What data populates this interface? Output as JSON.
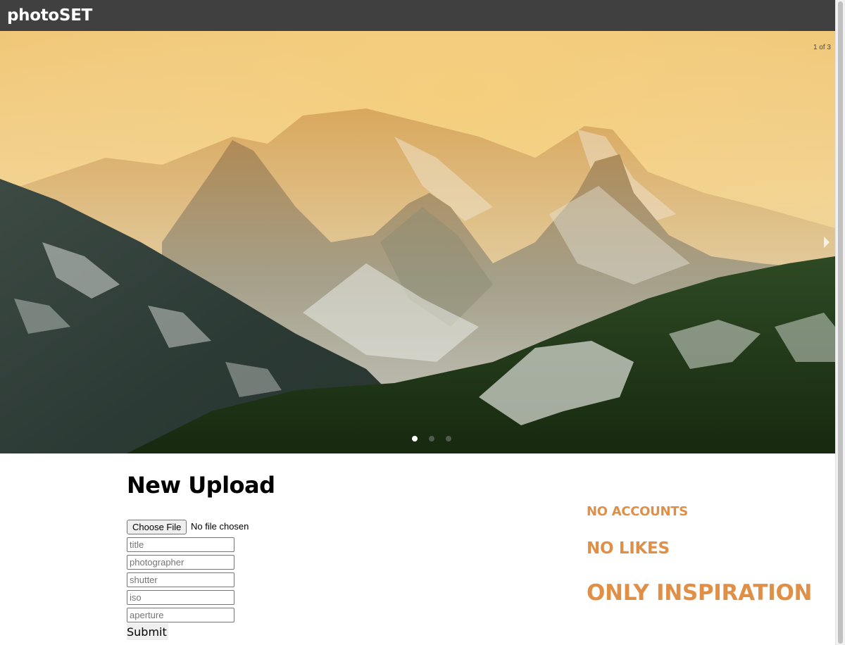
{
  "header": {
    "brand": "photoSET"
  },
  "carousel": {
    "counter": "1 of 3",
    "dots": 3,
    "active_dot": 1,
    "image": "snowy-mountains-golden-haze"
  },
  "upload": {
    "title": "New Upload",
    "file_button": "Choose File",
    "file_status": "No file chosen",
    "fields": {
      "title": "title",
      "photographer": "photographer",
      "shutter": "shutter",
      "iso": "iso",
      "aperture": "aperture"
    },
    "submit": "Submit"
  },
  "taglines": [
    "NO ACCOUNTS",
    "NO LIKES",
    "ONLY INSPIRATION"
  ],
  "colors": {
    "accent": "#e08f47",
    "topbar": "#404040"
  }
}
